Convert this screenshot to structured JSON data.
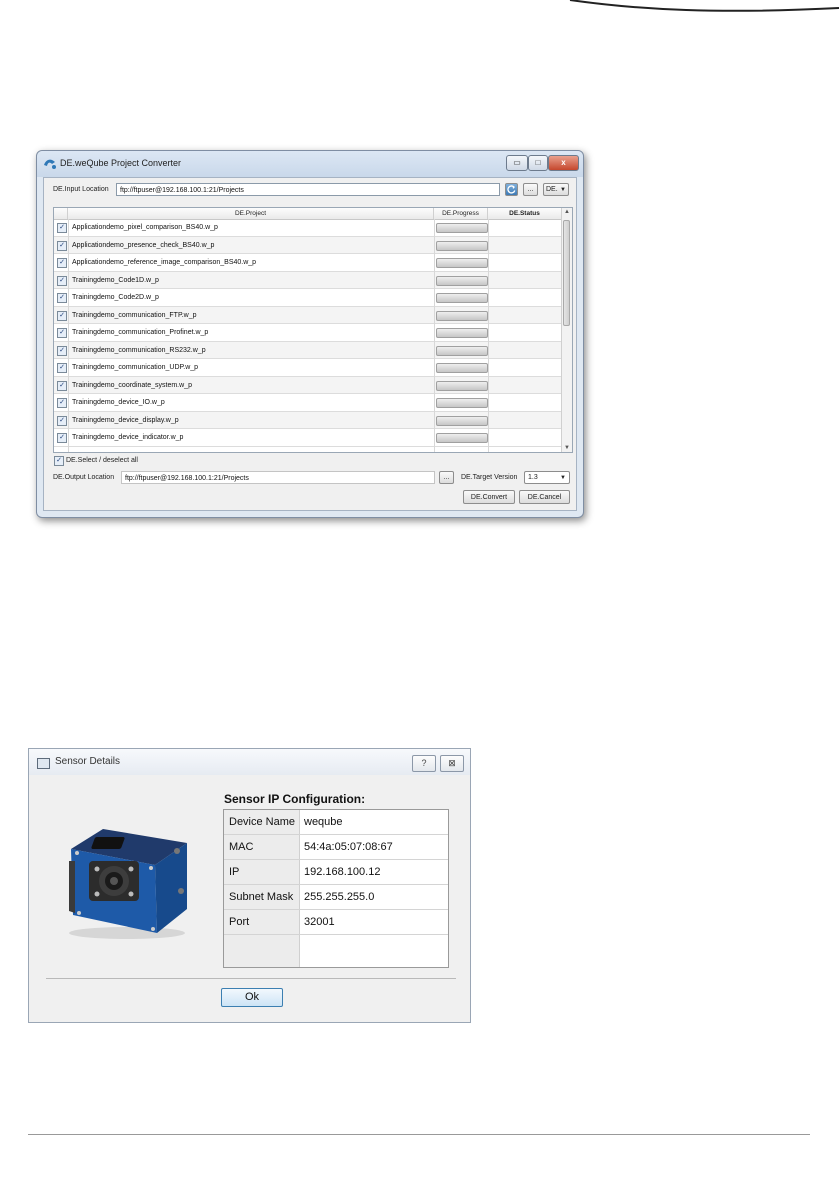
{
  "converter": {
    "title": "DE.weQube Project Converter",
    "window_buttons": {
      "minimize": "▭",
      "maximize": "□",
      "close": "x"
    },
    "input_location_label": "DE.Input Location",
    "input_location_value": "ftp://ftpuser@192.168.100.1:21/Projects",
    "refresh_icon": "refresh-icon",
    "browse_label": "...",
    "language_value": "DE.",
    "columns": {
      "project": "DE.Project",
      "progress": "DE.Progress",
      "status": "DE.Status"
    },
    "rows": [
      {
        "name": "Applicationdemo_pixel_comparison_BS40.w_p",
        "checked": true,
        "progress": 0,
        "status": ""
      },
      {
        "name": "Applicationdemo_presence_check_BS40.w_p",
        "checked": true,
        "progress": 0,
        "status": ""
      },
      {
        "name": "Applicationdemo_reference_image_comparison_BS40.w_p",
        "checked": true,
        "progress": 0,
        "status": ""
      },
      {
        "name": "Trainingdemo_Code1D.w_p",
        "checked": true,
        "progress": 0,
        "status": ""
      },
      {
        "name": "Trainingdemo_Code2D.w_p",
        "checked": true,
        "progress": 0,
        "status": ""
      },
      {
        "name": "Trainingdemo_communication_FTP.w_p",
        "checked": true,
        "progress": 0,
        "status": ""
      },
      {
        "name": "Trainingdemo_communication_Profinet.w_p",
        "checked": true,
        "progress": 0,
        "status": ""
      },
      {
        "name": "Trainingdemo_communication_RS232.w_p",
        "checked": true,
        "progress": 0,
        "status": ""
      },
      {
        "name": "Trainingdemo_communication_UDP.w_p",
        "checked": true,
        "progress": 0,
        "status": ""
      },
      {
        "name": "Trainingdemo_coordinate_system.w_p",
        "checked": true,
        "progress": 0,
        "status": ""
      },
      {
        "name": "Trainingdemo_device_IO.w_p",
        "checked": true,
        "progress": 0,
        "status": ""
      },
      {
        "name": "Trainingdemo_device_display.w_p",
        "checked": true,
        "progress": 0,
        "status": ""
      },
      {
        "name": "Trainingdemo_device_indicator.w_p",
        "checked": true,
        "progress": 0,
        "status": ""
      }
    ],
    "select_all_label": "DE.Select / deselect all",
    "select_all_checked": true,
    "output_location_label": "DE.Output Location",
    "output_location_value": "ftp://ftpuser@192.168.100.1:21/Projects",
    "target_version_label": "DE.Target Version",
    "target_version_value": "1.3",
    "convert_label": "DE.Convert",
    "cancel_label": "DE.Cancel"
  },
  "sensor_details": {
    "title": "Sensor Details",
    "help_button": "?",
    "close_button": "⊠",
    "heading": "Sensor IP Configuration:",
    "fields": [
      {
        "key": "Device Name",
        "value": "weqube"
      },
      {
        "key": "MAC",
        "value": "54:4a:05:07:08:67"
      },
      {
        "key": "IP",
        "value": "192.168.100.12"
      },
      {
        "key": "Subnet Mask",
        "value": "255.255.255.0"
      },
      {
        "key": "Port",
        "value": "32001"
      }
    ],
    "ok_label": "Ok"
  },
  "colors": {
    "progress_fill": "#5fae47",
    "close_button": "#c5472d"
  }
}
